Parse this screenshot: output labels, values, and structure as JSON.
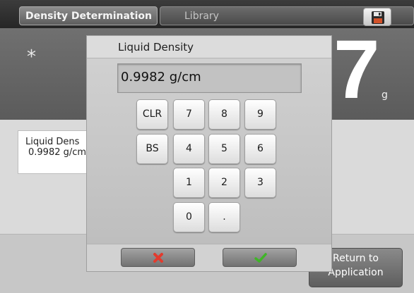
{
  "tabs": [
    {
      "label": "Density Determination",
      "active": true
    },
    {
      "label": "Library",
      "active": false
    }
  ],
  "icons": {
    "save": "floppy-disk-icon",
    "cancel": "red-x-icon",
    "accept": "green-check-icon"
  },
  "weighing": {
    "marker": "*",
    "digit": "7",
    "unit": "g"
  },
  "liquid_card": {
    "label": "Liquid Dens",
    "value": "0.9982 g/cm"
  },
  "return_button": {
    "line1": "Return to",
    "line2": "Application"
  },
  "dialog": {
    "title": "Liquid Density",
    "input_value": "0.9982 g/cm",
    "keys": {
      "clr": "CLR",
      "bs": "BS",
      "k7": "7",
      "k8": "8",
      "k9": "9",
      "k4": "4",
      "k5": "5",
      "k6": "6",
      "k1": "1",
      "k2": "2",
      "k3": "3",
      "k0": "0",
      "dot": "."
    }
  },
  "colors": {
    "cancel": "#e23b2e",
    "accept": "#3fb527"
  }
}
